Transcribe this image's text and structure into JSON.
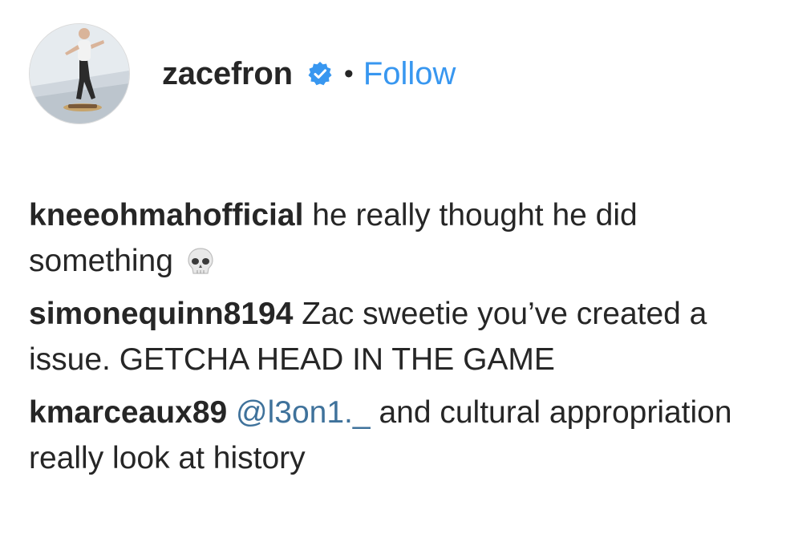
{
  "post_header": {
    "username": "zacefron",
    "verified_icon": "verified-badge-icon",
    "separator": "•",
    "follow_label": "Follow",
    "follow_color": "#3897f0"
  },
  "comments": [
    {
      "author": "kneeohmahofficial",
      "text": "he really thought he did something",
      "emoji": "skull-icon"
    },
    {
      "author": "simonequinn8194",
      "text": "Zac sweetie you’ve created a issue. GETCHA HEAD IN THE GAME"
    },
    {
      "author": "kmarceaux89",
      "mention": "@l3on1._",
      "text": "and cultural appropriation really look at history",
      "mention_color": "#3f729b"
    }
  ]
}
